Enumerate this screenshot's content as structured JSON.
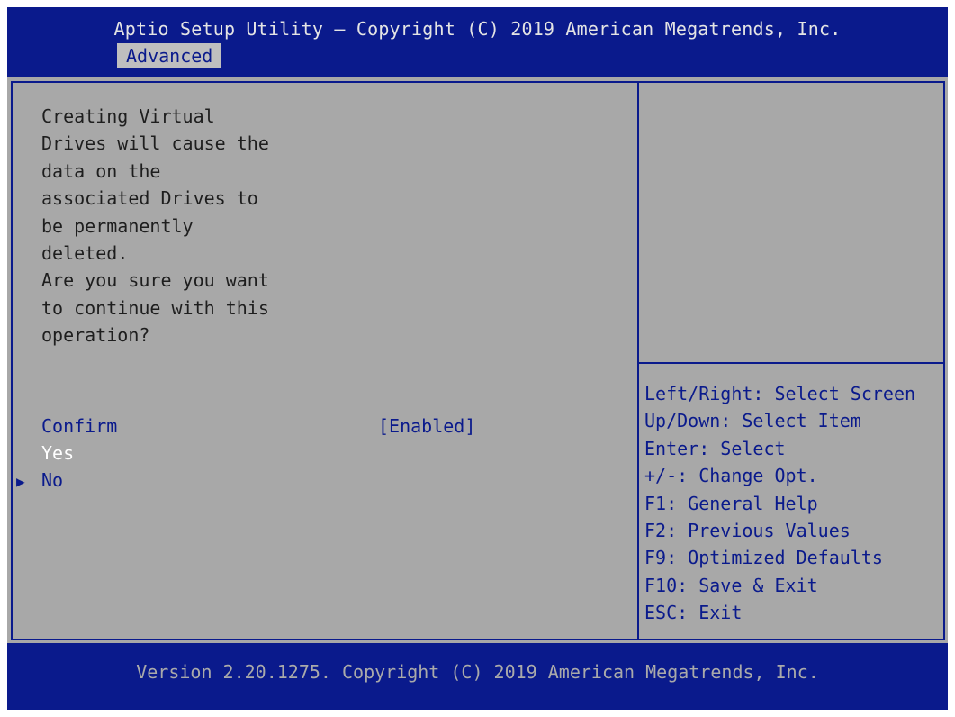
{
  "header": {
    "title": "Aptio Setup Utility – Copyright (C) 2019 American Megatrends, Inc.",
    "active_tab": "Advanced"
  },
  "warning": {
    "lines": [
      "Creating Virtual",
      "Drives will cause the",
      "data on the",
      "associated Drives to",
      "be permanently",
      "deleted.",
      "Are you sure you want",
      "to continue with this",
      "operation?"
    ]
  },
  "menu": {
    "confirm_label": "Confirm",
    "confirm_value": "[Enabled]",
    "yes_label": "Yes",
    "no_label": "No",
    "selected_marker": "▶"
  },
  "help": {
    "lines": [
      "Left/Right: Select Screen",
      "Up/Down: Select Item",
      "Enter: Select",
      "+/-: Change Opt.",
      "F1: General Help",
      "F2: Previous Values",
      "F9: Optimized Defaults",
      "F10: Save & Exit",
      "ESC: Exit"
    ]
  },
  "footer": {
    "text": "Version 2.20.1275. Copyright (C) 2019 American Megatrends, Inc."
  },
  "colors": {
    "bios_blue": "#0a1a8c",
    "panel_gray": "#a8a8a8",
    "tab_gray": "#bfbfbf",
    "title_text": "#e4e4e4",
    "highlight_white": "#ffffff"
  }
}
